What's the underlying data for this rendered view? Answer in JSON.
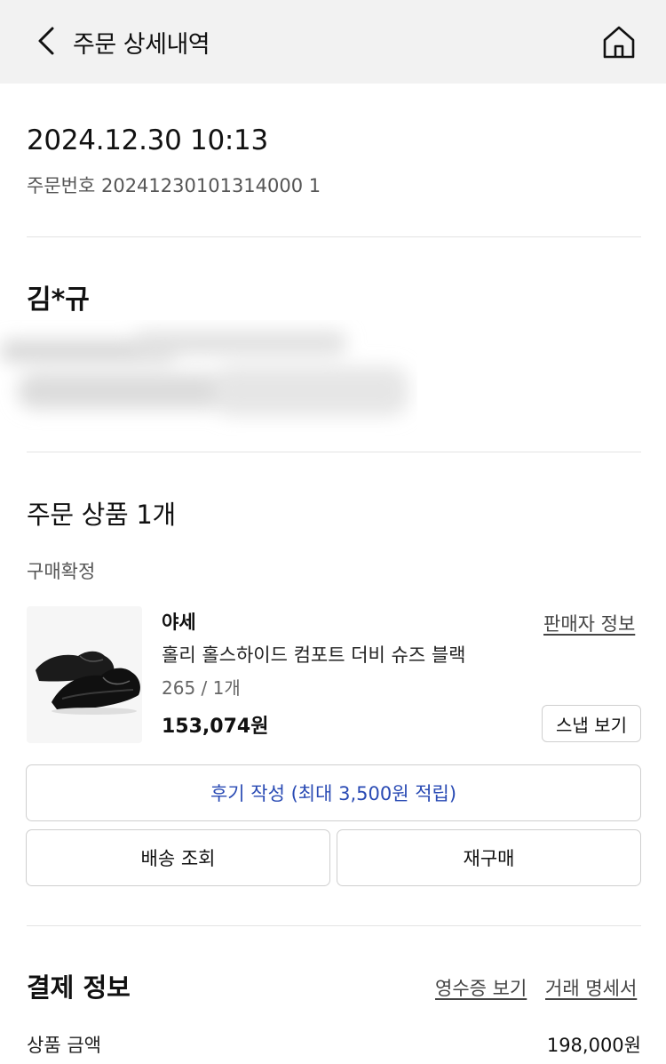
{
  "header": {
    "title": "주문 상세내역",
    "back_icon": "chevron-left-icon",
    "home_icon": "home-icon"
  },
  "order": {
    "datetime": "2024.12.30 10:13",
    "number_label": "주문번호",
    "number": "20241230101314000 1"
  },
  "buyer": {
    "name": "김*규"
  },
  "items_section": {
    "title": "주문 상품 1개",
    "status": "구매확정"
  },
  "product": {
    "brand": "야세",
    "seller_info_label": "판매자 정보",
    "name": "홀리 홀스하이드 컴포트 더비 슈즈 블랙",
    "option": "265 / 1개",
    "price": "153,074원",
    "snap_label": "스냅 보기"
  },
  "actions": {
    "review_label": "후기 작성  (최대 3,500원 적립)",
    "shipping_label": "배송 조회",
    "rebuy_label": "재구매"
  },
  "payment": {
    "title": "결제 정보",
    "receipt_label": "영수증 보기",
    "statement_label": "거래 명세서",
    "product_amount_label": "상품 금액",
    "product_amount_value": "198,000원"
  },
  "colors": {
    "header_bg": "#f2f2f2",
    "link_blue": "#2a4bb4",
    "border": "#cfcfcf"
  }
}
